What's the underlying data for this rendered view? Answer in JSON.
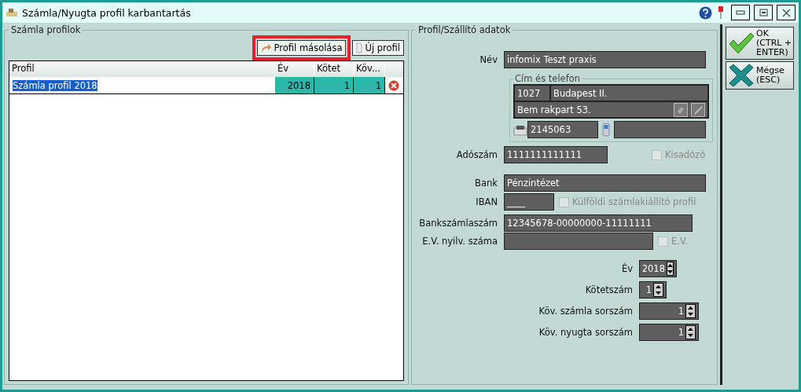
{
  "window": {
    "title": "Számla/Nyugta profil karbantartás"
  },
  "profiles": {
    "title": "Számla profilok",
    "buttons": [
      {
        "label": "Profil másolása",
        "highlighted": true,
        "kind": "copy"
      },
      {
        "label": "Új profil",
        "highlighted": false,
        "kind": "new"
      }
    ],
    "table": {
      "columns": [
        "Profil",
        "Év",
        "Kötet",
        "Köv..."
      ],
      "rows": [
        {
          "selected": true,
          "cells": [
            "Számla profil 2018",
            "2018",
            "1",
            "1"
          ]
        }
      ]
    }
  },
  "details": {
    "title": "Profil/Szállító adatok",
    "name": {
      "label": "Név",
      "value": "infomix Teszt praxis"
    },
    "address": {
      "title": "Cím és telefon",
      "zip": "1027",
      "city": "Budapest II.",
      "street": "Bem rakpart 53.",
      "phone": "2145063"
    },
    "tax": {
      "label": "Adószám",
      "value": "1111111111111",
      "checkbox": {
        "label": "Kisadózó",
        "checked": false,
        "disabled": true
      }
    },
    "bank": {
      "label": "Bank",
      "value": "Pénzintézet"
    },
    "iban": {
      "label": "IBAN",
      "value": "____",
      "checkbox": {
        "label": "Külföldi számlakiállító profil",
        "checked": false,
        "disabled": true
      }
    },
    "account": {
      "label": "Bankszámlaszám",
      "value": "12345678-00000000-11111111"
    },
    "ev": {
      "label": "E.V. nyilv. száma",
      "checkbox": {
        "label": "E.V.",
        "checked": false,
        "disabled": true
      }
    },
    "spinners": [
      {
        "label": "Év",
        "value": "2018"
      },
      {
        "label": "Kötetszám",
        "value": "1"
      },
      {
        "label": "Köv. számla sorszám",
        "value": "1"
      },
      {
        "label": "Köv. nyugta sorszám",
        "value": "1"
      }
    ]
  },
  "actions": [
    {
      "kind": "ok",
      "lines": [
        "OK",
        "(CTRL +",
        "ENTER)"
      ]
    },
    {
      "kind": "cancel",
      "lines": [
        "Mégse",
        "(ESC)"
      ]
    }
  ]
}
